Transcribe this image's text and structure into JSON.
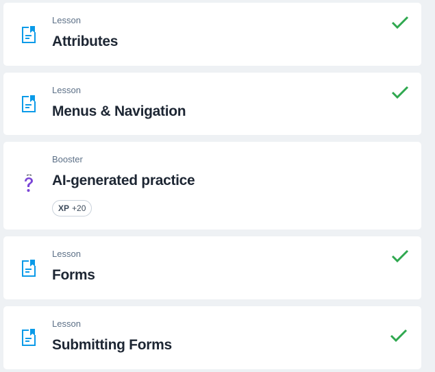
{
  "items": [
    {
      "type": "Lesson",
      "title": "Attributes",
      "completed": true
    },
    {
      "type": "Lesson",
      "title": "Menus & Navigation",
      "completed": true
    },
    {
      "type": "Booster",
      "title": "AI-generated practice",
      "xp_label": "XP",
      "xp_value": "+20",
      "completed": false
    },
    {
      "type": "Lesson",
      "title": "Forms",
      "completed": true
    },
    {
      "type": "Lesson",
      "title": "Submitting Forms",
      "completed": true
    }
  ],
  "colors": {
    "lesson_icon": "#0a9ae8",
    "booster_icon": "#7a45d6",
    "check": "#2fa84f"
  }
}
